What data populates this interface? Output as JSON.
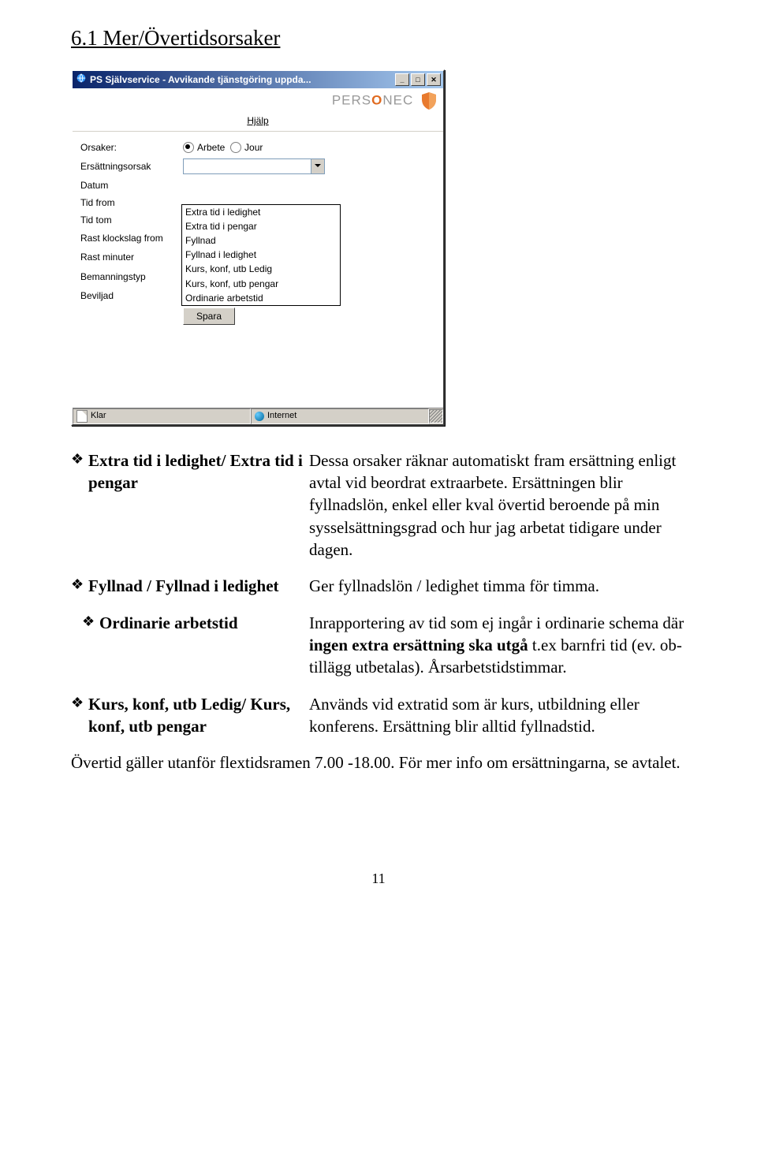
{
  "heading": "6.1 Mer/Övertidsorsaker",
  "dialog": {
    "title": "PS Självservice - Avvikande tjänstgöring uppda...",
    "brand_plain": "PERS",
    "brand_orange": "O",
    "brand_plain2": "NEC",
    "help": "Hjälp",
    "orsaker_label": "Orsaker:",
    "radio_arbete": "Arbete",
    "radio_jour": "Jour",
    "labels": {
      "ersattningsorsak": "Ersättningsorsak",
      "datum": "Datum",
      "tid_from": "Tid from",
      "tid_tom": "Tid tom",
      "rast_from": "Rast klockslag from",
      "rast_min": "Rast minuter",
      "bemanningstyp": "Bemanningstyp",
      "beviljad": "Beviljad"
    },
    "dropdown": [
      "Extra tid i ledighet",
      "Extra tid i pengar",
      "Fyllnad",
      "Fyllnad i ledighet",
      "Kurs, konf, utb Ledig",
      "Kurs, konf, utb pengar",
      "Ordinarie arbetstid"
    ],
    "save": "Spara",
    "status_left": "Klar",
    "status_right": "Internet"
  },
  "bullets": [
    {
      "term": "Extra tid i ledighet/ Extra tid i pengar",
      "desc": "Dessa orsaker räknar automatiskt fram ersättning enligt avtal vid beordrat extraarbete. Ersättningen blir fyllnadslön, enkel eller kval övertid beroende på min sysselsättningsgrad och hur jag arbetat tidigare under dagen."
    },
    {
      "term": "Fyllnad / Fyllnad i ledighet",
      "desc": "Ger fyllnadslön / ledighet timma för timma."
    },
    {
      "term": "Ordinarie arbetstid",
      "desc_pre": "Inrapportering av tid som ej ingår i ordinarie schema där ",
      "desc_bold": "ingen extra ersättning ska utgå",
      "desc_post": " t.ex barnfri tid (ev. ob-tillägg utbetalas). Årsarbetstidstimmar.",
      "indent": true
    },
    {
      "term": "Kurs, konf, utb Ledig/ Kurs, konf, utb pengar",
      "desc": "Används vid extratid som är kurs, utbildning eller konferens. Ersättning blir alltid fyllnadstid."
    }
  ],
  "footer_para": "Övertid gäller utanför flextidsramen 7.00 -18.00. För mer info om ersättningarna, se avtalet.",
  "page_number": "11"
}
